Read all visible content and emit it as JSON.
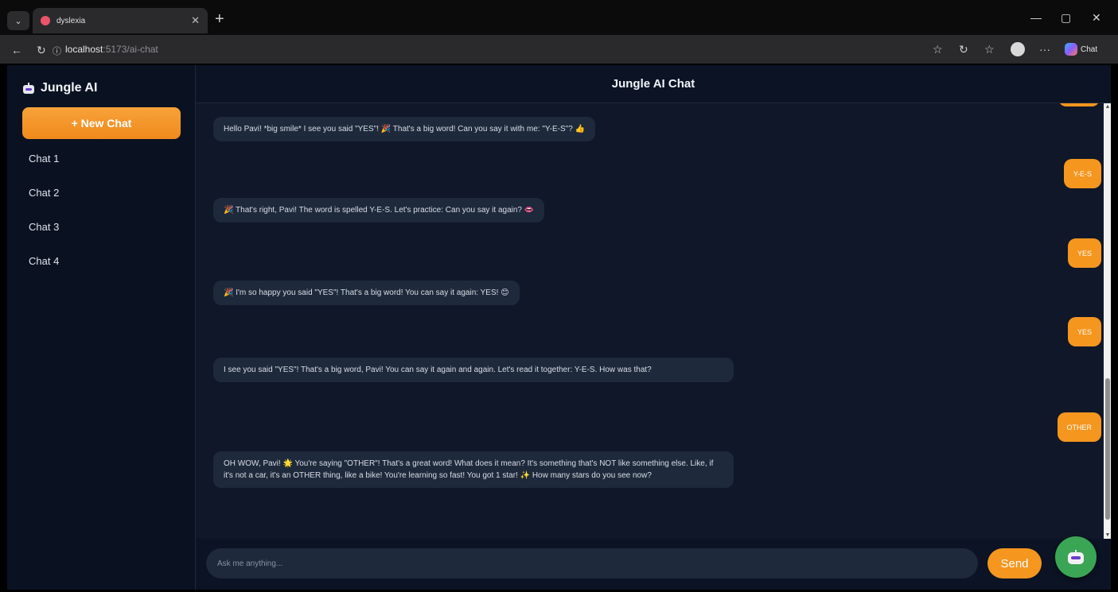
{
  "browser": {
    "tab_title": "dyslexia",
    "tab_close": "✕",
    "new_tab": "+",
    "url_host": "localhost",
    "url_path": ":5173/ai-chat",
    "copilot_label": "Chat",
    "window_controls": [
      "—",
      "▢",
      "✕"
    ],
    "icons": [
      "favorites-star-icon",
      "refresh-ext-icon",
      "favorites-icon",
      "profile-icon",
      "more-icon",
      "copilot-icon"
    ]
  },
  "sidebar": {
    "brand": "Jungle AI",
    "new_chat_label": "+ New Chat",
    "chats": [
      {
        "label": "Chat 1"
      },
      {
        "label": "Chat 2"
      },
      {
        "label": "Chat 3"
      },
      {
        "label": "Chat 4"
      }
    ]
  },
  "header": {
    "title": "Jungle AI Chat"
  },
  "messages": [
    {
      "role": "bot",
      "text": "Hello Pavi! *big smile* I see you said \"YES\"! 🎉 That's a big word! Can you say it with me: \"Y-E-S\"? 👍"
    },
    {
      "role": "user",
      "text": "Y-E-S"
    },
    {
      "role": "bot",
      "text": "🎉 That's right, Pavi! The word is spelled Y-E-S. Let's practice: Can you say it again? 👄"
    },
    {
      "role": "user",
      "text": "YES"
    },
    {
      "role": "bot",
      "text": "🎉 I'm so happy you said \"YES\"! That's a big word! You can say it again: YES! 😊"
    },
    {
      "role": "user",
      "text": "YES"
    },
    {
      "role": "bot",
      "text": "I see you said \"YES\"! That's a big word, Pavi! You can say it again and again. Let's read it together: Y-E-S. How was that?"
    },
    {
      "role": "user",
      "text": "OTHER"
    },
    {
      "role": "bot",
      "text": "OH WOW, Pavi! 🌟 You're saying \"OTHER\"! That's a great word! What does it mean? It's something that's NOT like something else. Like, if it's not a car, it's an OTHER thing, like a bike! You're learning so fast! You got 1 star! ✨ How many stars do you see now?"
    }
  ],
  "input": {
    "placeholder": "Ask me anything...",
    "value": "",
    "send_label": "Send"
  },
  "colors": {
    "accent": "#f5961f",
    "bg": "#0f1729",
    "bubble": "#1e293b",
    "fab": "#3aa655"
  }
}
